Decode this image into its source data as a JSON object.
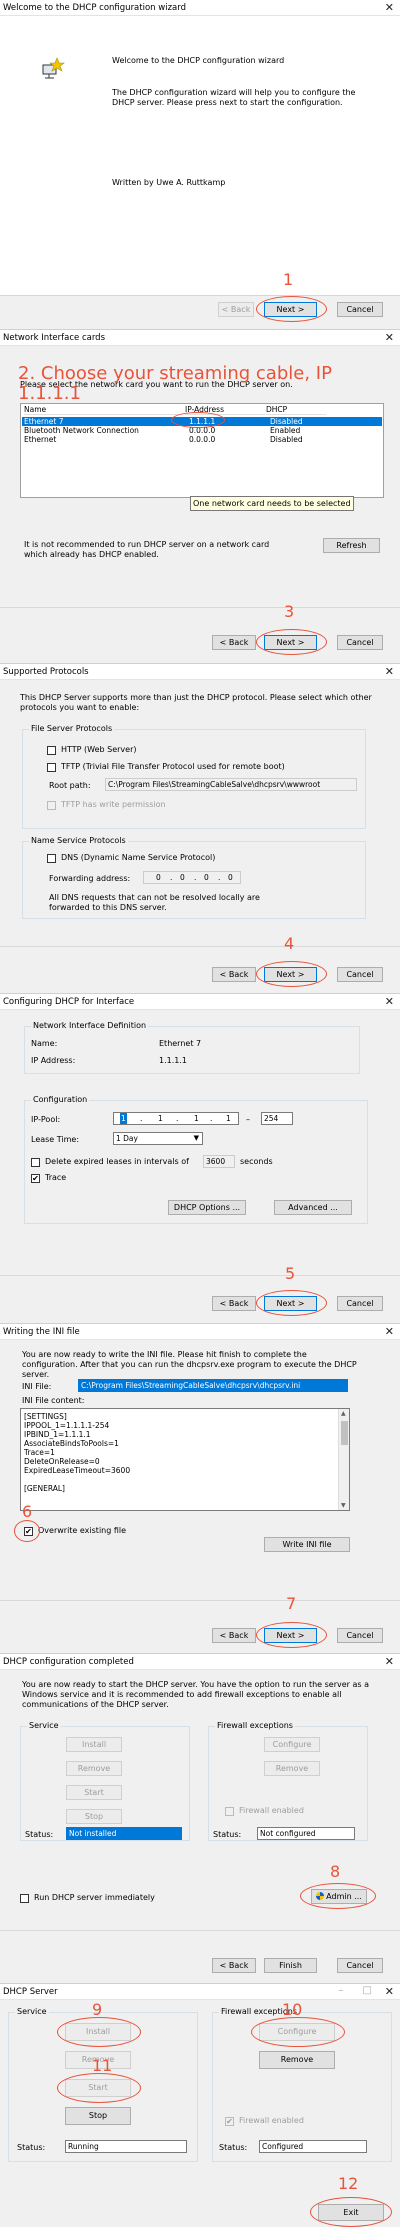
{
  "w1": {
    "title": "Welcome to the DHCP configuration wizard",
    "close": "✕",
    "heading": "Welcome to the DHCP configuration wizard",
    "body": "The DHCP configuration wizard will help you to configure the DHCP server. Please press next to start the configuration.",
    "author": "Written by Uwe A. Ruttkamp",
    "back": "< Back",
    "next": "Next >",
    "cancel": "Cancel",
    "annotation": "1"
  },
  "w2": {
    "title": "Network Interface cards",
    "close": "✕",
    "overlay": "2. Choose your streaming cable, IP 1.1.1.1",
    "prompt": "Please select the network card you want to run the DHCP server on.",
    "columns": [
      "Name",
      "IP-Address",
      "DHCP"
    ],
    "rows": [
      {
        "name": "Ethernet 7",
        "ip": "1.1.1.1",
        "dhcp": "Disabled"
      },
      {
        "name": "Bluetooth Network Connection",
        "ip": "0.0.0.0",
        "dhcp": "Enabled"
      },
      {
        "name": "Ethernet",
        "ip": "0.0.0.0",
        "dhcp": "Disabled"
      }
    ],
    "tooltip": "One network card needs to be selected",
    "warning": "It is not recommended to run DHCP server on a network card which already has DHCP enabled.",
    "refresh": "Refresh",
    "back": "< Back",
    "next": "Next >",
    "cancel": "Cancel",
    "annotation": "3"
  },
  "w3": {
    "title": "Supported Protocols",
    "close": "✕",
    "intro": "This DHCP Server supports more than just the DHCP protocol. Please select which other protocols you want to enable:",
    "file_group": "File Server Protocols",
    "http": "HTTP (Web Server)",
    "tftp": "TFTP (Trivial File Transfer Protocol used for remote boot)",
    "root_label": "Root path:",
    "root_value": "C:\\Program Files\\StreamingCableSalve\\dhcpsrv\\wwwroot",
    "tftp_write": "TFTP has write permission",
    "name_group": "Name Service Protocols",
    "dns": "DNS (Dynamic Name Service Protocol)",
    "fwd_label": "Forwarding address:",
    "fwd_ip": [
      "0",
      "0",
      "0",
      "0"
    ],
    "dns_note": "All DNS requests that can not be resolved locally are forwarded to this DNS server.",
    "back": "< Back",
    "next": "Next >",
    "cancel": "Cancel",
    "annotation": "4"
  },
  "w4": {
    "title": "Configuring DHCP for Interface",
    "close": "✕",
    "nid_group": "Network Interface Definition",
    "name_label": "Name:",
    "name_value": "Ethernet 7",
    "ip_label": "IP Address:",
    "ip_value": "1.1.1.1",
    "config_group": "Configuration",
    "pool_label": "IP-Pool:",
    "pool_ip": [
      "1",
      "1",
      "1",
      "1"
    ],
    "pool_dash": "–",
    "pool_end": "254",
    "lease_label": "Lease Time:",
    "lease_value": "1 Day",
    "delete_label": "Delete expired leases in intervals of",
    "delete_value": "3600",
    "delete_unit": "seconds",
    "trace": "Trace",
    "dhcp_options": "DHCP Options ...",
    "advanced": "Advanced ...",
    "back": "< Back",
    "next": "Next >",
    "cancel": "Cancel",
    "annotation": "5"
  },
  "w5": {
    "title": "Writing the INI file",
    "close": "✕",
    "intro": "You are now ready to write the INI file. Please hit finish to complete the configuration. After that you can run the dhcpsrv.exe program to execute the DHCP server.",
    "ini_label": "INI File:",
    "ini_value": "C:\\Program Files\\StreamingCableSalve\\dhcpsrv\\dhcpsrv.ini",
    "content_label": "INI File content:",
    "content_lines": [
      "[SETTINGS]",
      "IPPOOL_1=1.1.1.1-254",
      "IPBIND_1=1.1.1.1",
      "AssociateBindsToPools=1",
      "Trace=1",
      "DeleteOnRelease=0",
      "ExpiredLeaseTimeout=3600",
      "",
      "[GENERAL]"
    ],
    "overwrite": "Overwrite existing file",
    "write_ini": "Write INI file",
    "back": "< Back",
    "next": "Next >",
    "cancel": "Cancel",
    "annotation_overwrite": "6",
    "annotation_next": "7"
  },
  "w6": {
    "title": "DHCP configuration completed",
    "close": "✕",
    "intro": "You are now ready to start the DHCP server. You have the option to run the server as a Windows service and it is recommended to add firewall exceptions to enable all communications of the DHCP server.",
    "service_group": "Service",
    "install": "Install",
    "remove": "Remove",
    "start": "Start",
    "stop": "Stop",
    "status_label": "Status:",
    "status_value": "Not installed",
    "firewall_group": "Firewall exceptions",
    "configure": "Configure",
    "fw_remove": "Remove",
    "firewall_enabled": "Firewall enabled",
    "fw_status_label": "Status:",
    "fw_status_value": "Not configured",
    "admin": "Admin ...",
    "run_immediately": "Run DHCP server immediately",
    "back": "< Back",
    "finish": "Finish",
    "cancel": "Cancel",
    "annotation": "8"
  },
  "w7": {
    "title": "DHCP Server",
    "controls": "–  □",
    "close": "✕",
    "service_group": "Service",
    "install": "Install",
    "remove": "Remove",
    "start": "Start",
    "stop": "Stop",
    "status_label": "Status:",
    "status_value": "Running",
    "firewall_group": "Firewall exceptions",
    "configure": "Configure",
    "fw_remove": "Remove",
    "firewall_enabled": "Firewall enabled",
    "fw_status_label": "Status:",
    "fw_status_value": "Configured",
    "exit": "Exit",
    "annotation_install": "9",
    "annotation_start": "11",
    "annotation_configure": "10",
    "annotation_exit": "12"
  }
}
